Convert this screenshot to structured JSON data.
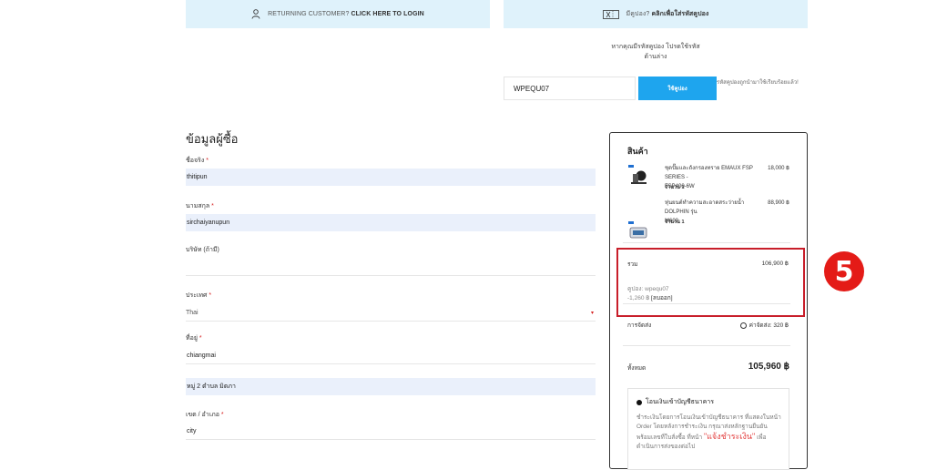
{
  "top": {
    "login_text_muted": "RETURNING CUSTOMER?",
    "login_link": "CLICK HERE TO LOGIN",
    "coupon_text_muted": "มีคูปอง?",
    "coupon_link": "คลิกเพื่อใส่รหัสคูปอง"
  },
  "coupon": {
    "note_line1": "หากคุณมีรหัสคูปอง โปรดใช้รหัส",
    "note_line2": "ด้านล่าง",
    "input_value": "WPEQU07",
    "apply_label": "ใช้คูปอง",
    "applied_msg": "รหัสคูปองถูกนำมาใช้เรียบร้อยแล้ว!"
  },
  "billing": {
    "title": "ข้อมูลผู้ซื้อ",
    "first_name_label": "ชื่อจริง",
    "first_name_value": "thitipun",
    "last_name_label": "นามสกุล",
    "last_name_value": "sirchaiyanupun",
    "company_label": "บริษัท (ถ้ามี)",
    "company_value": "",
    "country_label": "ประเทศ",
    "country_value": "Thai",
    "address_label": "ที่อยู่",
    "address_value": "chiangmai",
    "address2_value": "หมู่ 2 ตำบล มิตภา",
    "district_label": "เขต / อำเภอ",
    "district_value": "city",
    "required_mark": "*"
  },
  "summary": {
    "title": "สินค้า",
    "products": [
      {
        "name_line1": "ชุดปั๊มและถังกรองทราย EMAUX FSP SERIES -",
        "name_line2": "FSP400-6W",
        "price": "18,000 ฿",
        "qty": "จำนวน 1"
      },
      {
        "name_line1": "หุ่นยนต์ทำความสะอาดสระว่ายน้ำ DOLPHIN รุ่น",
        "name_line2": "M600",
        "price": "88,900 ฿",
        "qty": "จำนวน 1"
      }
    ],
    "subtotal_label": "รวม",
    "subtotal_value": "106,900 ฿",
    "coupon_label": "คูปอง: wpequ07",
    "coupon_discount": "-1,260 ฿",
    "coupon_remove": "[ลบออก]",
    "shipping_label": "การจัดส่ง",
    "shipping_value": "ค่าจัดส่ง: 320 ฿",
    "total_label": "ทั้งหมด",
    "total_value": "105,960 ฿",
    "payment_title": "โอนเงินเข้าบัญชีธนาคาร",
    "payment_desc1": "ชำระเงินโดยการโอนเงินเข้าบัญชีธนาคาร ที่แสดงในหน้า",
    "payment_desc2": "Order โดยหลังการชำระเงิน กรุณาส่งหลักฐานยืนยัน",
    "payment_desc3": "พร้อมเลขที่ใบสั่งซื้อ ที่หน้า",
    "payment_highlight": "\"แจ้งชำระเงิน\"",
    "payment_desc4": "เพื่อ",
    "payment_desc5": "ดำเนินการส่งของต่อไป"
  },
  "annotation": {
    "step_number": "5",
    "highlight_color": "#c81e2a"
  },
  "colors": {
    "topbar_bg": "#dff2fb",
    "accent_blue": "#1ea5ee",
    "field_fill": "#eaf0fb",
    "required_red": "#d61f1f"
  }
}
